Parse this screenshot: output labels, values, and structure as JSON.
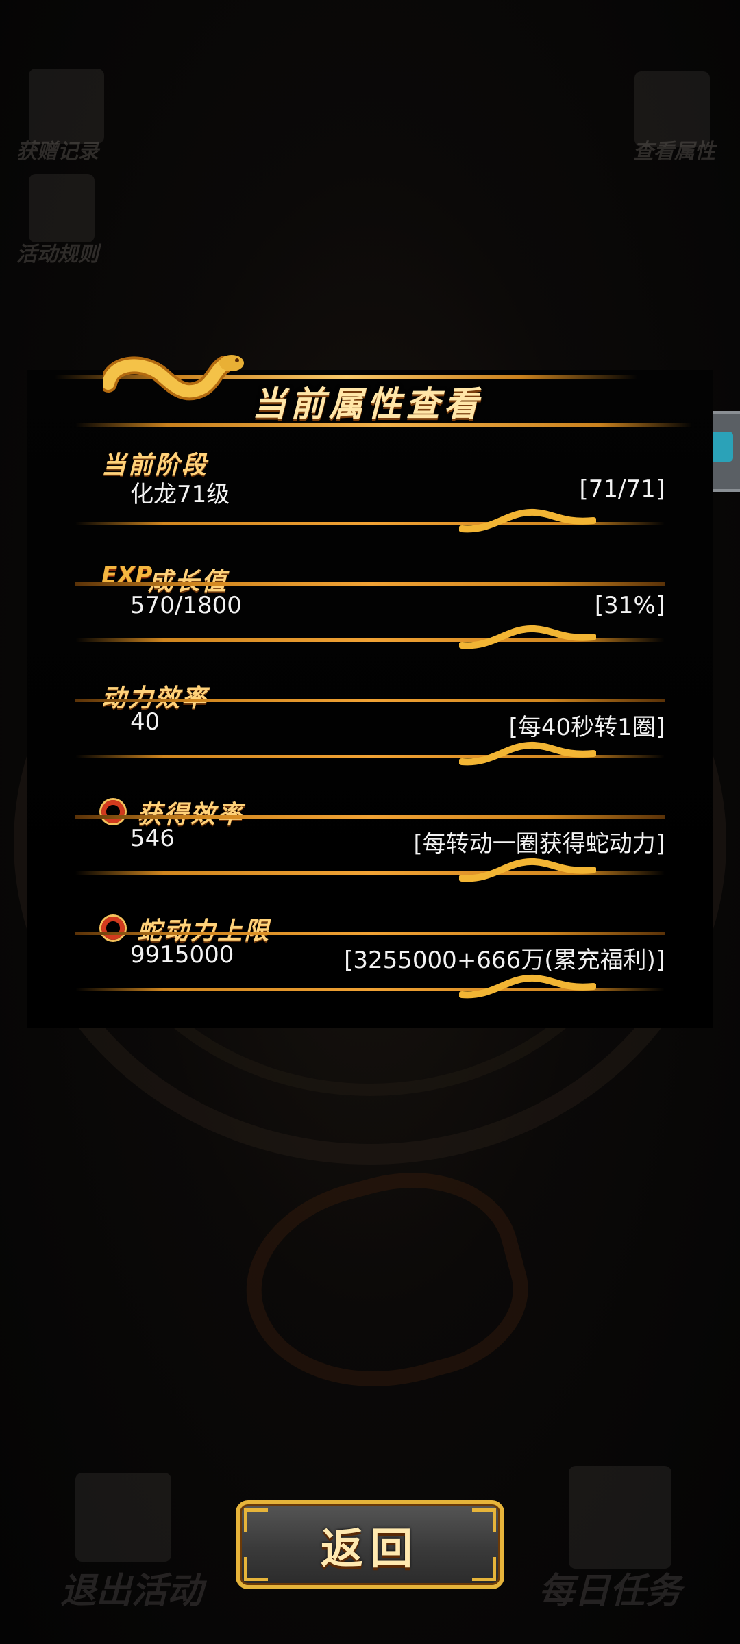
{
  "background": {
    "gift_record_label": "获赠记录",
    "activity_rules_label": "活动规则",
    "view_attributes_label": "查看属性",
    "exit_activity_label": "退出活动",
    "daily_tasks_label": "每日任务"
  },
  "panel": {
    "title": "当前属性查看",
    "sections": [
      {
        "label": "当前阶段",
        "left": "化龙71级",
        "right": "[71/71]"
      },
      {
        "label": "成长值",
        "icon_text": "EXP",
        "left": "570/1800",
        "right": "[31%]"
      },
      {
        "label": "动力效率",
        "left": "40",
        "right": "[每40秒转1圈]"
      },
      {
        "label": "获得效率",
        "left": "546",
        "right": "[每转动一圈获得蛇动力]"
      },
      {
        "label": "蛇动力上限",
        "left": "9915000",
        "right": "[3255000+666万(累充福利)]"
      }
    ]
  },
  "return_button": {
    "label": "返回"
  },
  "colors": {
    "gold": "#f0a235",
    "title": "#ffe6a8",
    "label": "#ffd27a",
    "value": "#f2f2f2"
  }
}
